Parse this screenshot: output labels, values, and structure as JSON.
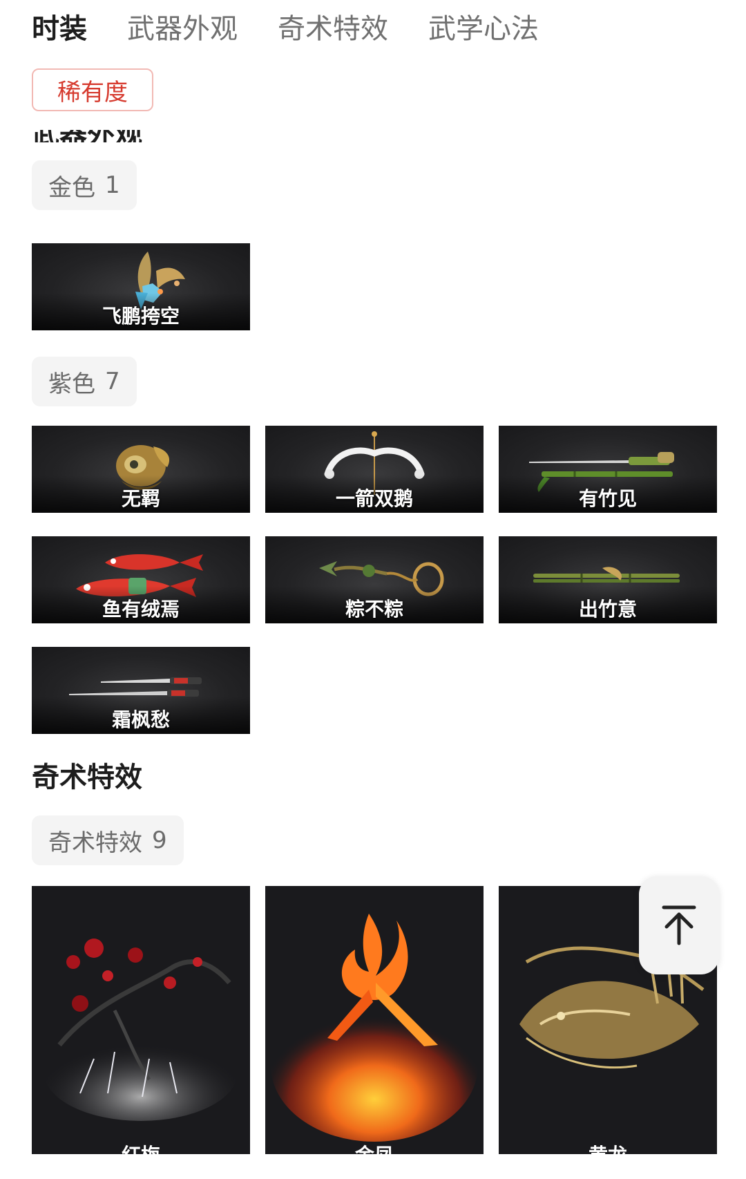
{
  "tabs": [
    {
      "label": "时装",
      "active": true
    },
    {
      "label": "武器外观",
      "active": false
    },
    {
      "label": "奇术特效",
      "active": false
    },
    {
      "label": "武学心法",
      "active": false
    }
  ],
  "filter": {
    "label": "稀有度"
  },
  "weapons_section": {
    "title": "武器外观",
    "groups": [
      {
        "name": "金色",
        "count": "1",
        "items": [
          {
            "name": "飞鹏挎空",
            "icon": "winged-weapon-icon"
          }
        ]
      },
      {
        "name": "紫色",
        "count": "7",
        "items": [
          {
            "name": "无羁",
            "icon": "golden-mask-icon"
          },
          {
            "name": "一箭双鹅",
            "icon": "white-bow-icon"
          },
          {
            "name": "有竹见",
            "icon": "bamboo-sword-icon"
          },
          {
            "name": "鱼有绒焉",
            "icon": "red-fish-icon"
          },
          {
            "name": "粽不粽",
            "icon": "rope-dart-icon"
          },
          {
            "name": "出竹意",
            "icon": "bamboo-staff-icon"
          },
          {
            "name": "霜枫愁",
            "icon": "twin-blades-icon"
          }
        ]
      }
    ]
  },
  "effects_section": {
    "title": "奇术特效",
    "groups": [
      {
        "name": "奇术特效",
        "count": "9",
        "items": [
          {
            "name": "红梅",
            "icon": "red-plum-blossom-icon"
          },
          {
            "name": "金凤",
            "icon": "fire-phoenix-icon"
          },
          {
            "name": "黄龙",
            "icon": "golden-dragon-icon"
          }
        ]
      }
    ]
  },
  "back_to_top": {
    "icon": "arrow-up-to-top-icon"
  }
}
